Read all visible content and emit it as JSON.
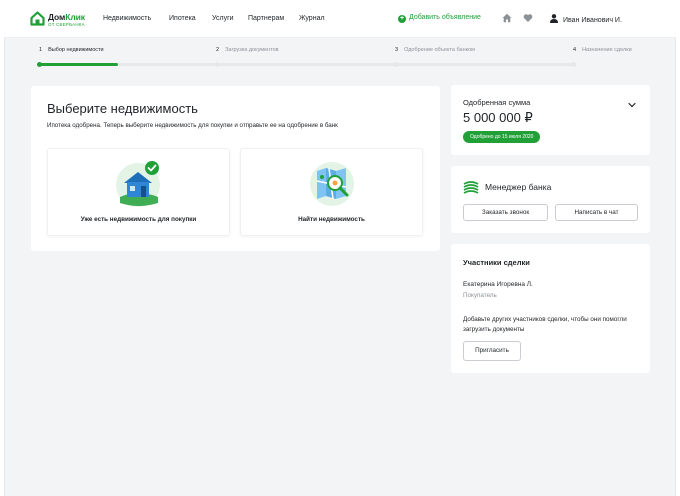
{
  "header": {
    "logo": {
      "name_main": "Дом",
      "name_accent": "Клик",
      "subtitle": "ОТ СБЕРБАНКА"
    },
    "nav": [
      "Недвижимость",
      "Ипотека",
      "Услуги",
      "Партнерам",
      "Журнал"
    ],
    "add_listing": "Добавить объявление",
    "user_name": "Иван Иванович И."
  },
  "steps": [
    {
      "num": "1",
      "label": "Выбор недвижимости"
    },
    {
      "num": "2",
      "label": "Загрузка документов"
    },
    {
      "num": "3",
      "label": "Одобрение объекта банком"
    },
    {
      "num": "4",
      "label": "Назначение сделки"
    }
  ],
  "progress": {
    "current_step": 1,
    "total_steps": 4,
    "fill_fraction": 0.145
  },
  "main": {
    "title": "Выберите недвижимость",
    "subtitle": "Ипотека одобрена. Теперь выберите недвижимость для покупки и отправьте ее на одобрение в банк",
    "options": [
      {
        "label": "Уже есть недвижимость для покупки",
        "icon": "house-check-icon"
      },
      {
        "label": "Найти недвижимость",
        "icon": "map-search-icon"
      }
    ]
  },
  "amount": {
    "label": "Одобренная сумма",
    "value": "5 000 000 ₽",
    "badge": "Одобрено до 15 июля 2020"
  },
  "manager": {
    "title": "Менеджер банка",
    "call_button": "Заказать звонок",
    "chat_button": "Написать в чат"
  },
  "participants": {
    "title": "Участники сделки",
    "name": "Екатерина Игоревна Л.",
    "role": "Покупатель",
    "description": "Добавьте других участников сделки, чтобы они помогли загрузить документы",
    "invite_button": "Пригласить"
  },
  "colors": {
    "accent": "#21a038",
    "background": "#f3f4f6",
    "text": "#1f2327",
    "muted": "#8c9196"
  }
}
